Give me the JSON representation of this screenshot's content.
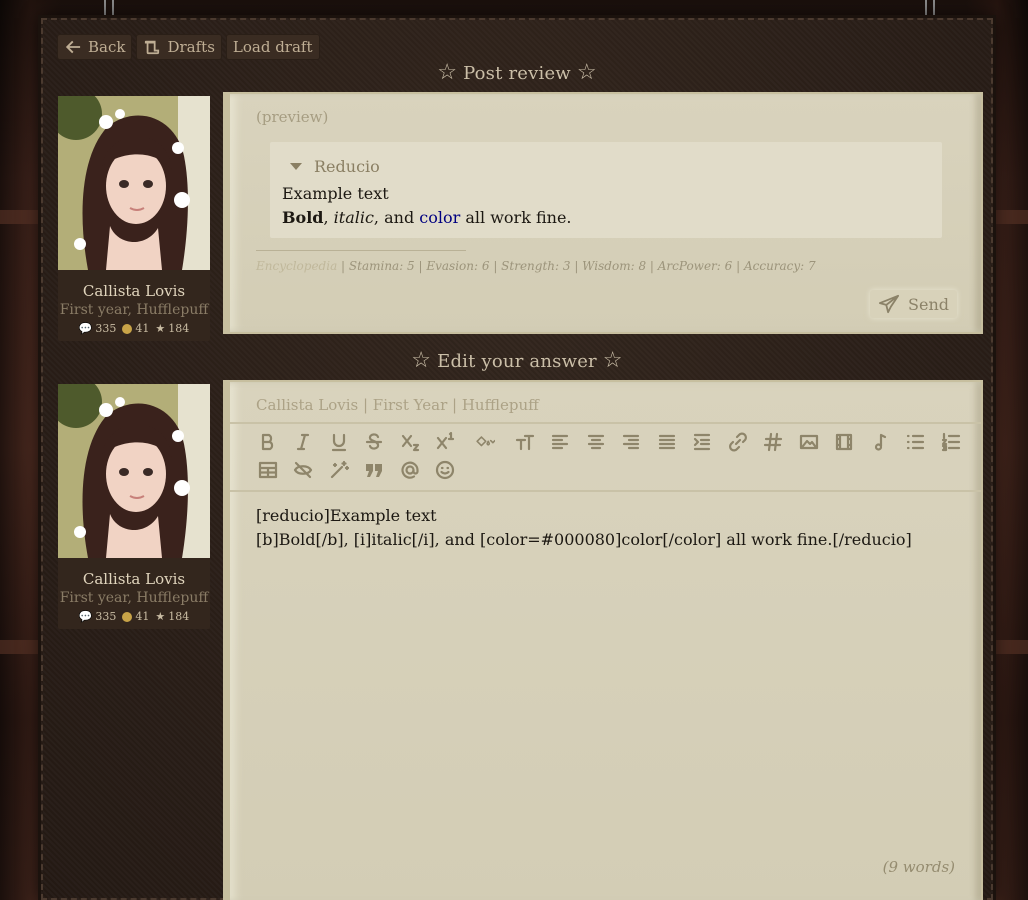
{
  "nav": {
    "back_label": "Back",
    "drafts_label": "Drafts",
    "load_draft_label": "Load draft"
  },
  "post_review": {
    "title": "Post review",
    "preview_label": "(preview)",
    "spoiler": {
      "title": "Reducio",
      "line1": "Example text",
      "bold": "Bold",
      "sep1": ", ",
      "italic": "italic",
      "sep2": ", and ",
      "color_word": "color",
      "rest": " all work fine."
    },
    "stats": {
      "encyclopedia": "Encyclopedia",
      "text": " | Stamina: 5 | Evasion: 6 | Strength: 3 | Wisdom: 8 | ArcPower: 6 | Accuracy: 7"
    },
    "send_label": "Send"
  },
  "profile": {
    "name": "Callista Lovis",
    "house": "First year, Hufflepuff",
    "posts": "335",
    "coins": "41",
    "stars": "184"
  },
  "edit": {
    "title": "Edit your answer",
    "header": "Callista Lovis | First Year | Hufflepuff",
    "line1": "[reducio]Example text",
    "line2": "[b]Bold[/b], [i]italic[/i], and [color=#000080]color[/color] all work fine.[/reducio]",
    "word_count": "(9 words)"
  },
  "colors": {
    "parchment": "#d9d3bd",
    "board": "#2a1f19",
    "link_color": "#000080"
  }
}
